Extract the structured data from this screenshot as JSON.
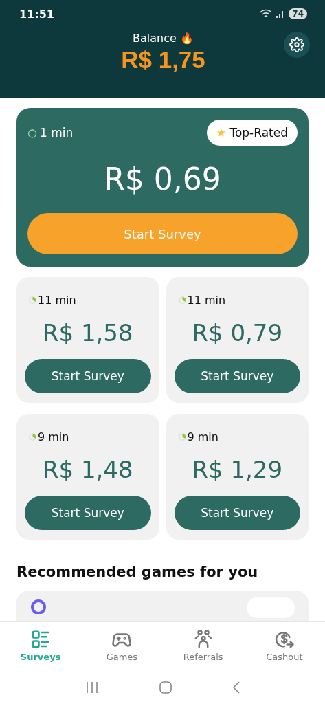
{
  "status_bar": {
    "time": "11:51",
    "battery": "74"
  },
  "header": {
    "label": "Balance 🔥",
    "balance": "R$ 1,75"
  },
  "featured": {
    "duration": "1 min",
    "badge": "Top-Rated",
    "reward": "R$ 0,69",
    "button": "Start Survey"
  },
  "surveys": [
    {
      "duration": "11 min",
      "reward": "R$ 1,58",
      "button": "Start Survey"
    },
    {
      "duration": "11 min",
      "reward": "R$ 0,79",
      "button": "Start Survey"
    },
    {
      "duration": "9 min",
      "reward": "R$ 1,48",
      "button": "Start Survey"
    },
    {
      "duration": "9 min",
      "reward": "R$ 1,29",
      "button": "Start Survey"
    }
  ],
  "games_heading": "Recommended games for you",
  "nav": [
    {
      "label": "Surveys",
      "kind": "surveys",
      "selected": true
    },
    {
      "label": "Games",
      "kind": "games",
      "selected": false
    },
    {
      "label": "Referrals",
      "kind": "referrals",
      "selected": false
    },
    {
      "label": "Cashout",
      "kind": "cashout",
      "selected": false
    }
  ]
}
